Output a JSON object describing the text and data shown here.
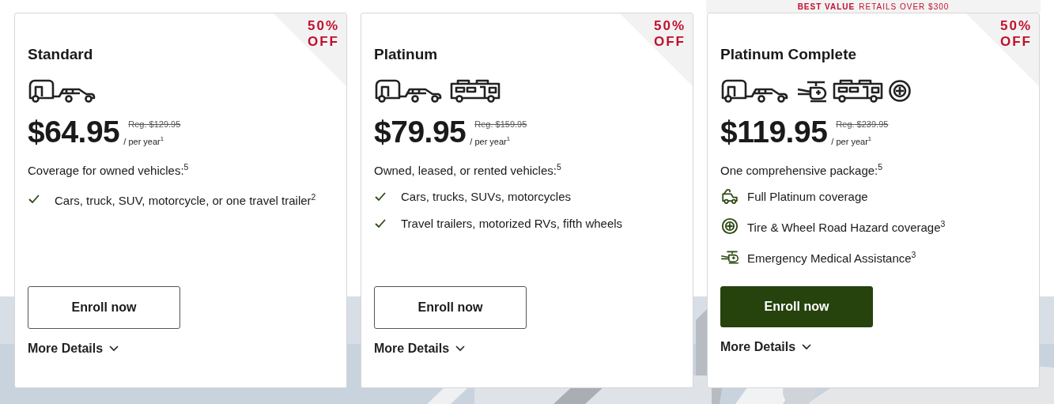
{
  "plans": [
    {
      "name": "Standard",
      "discount": [
        "50%",
        "OFF"
      ],
      "vehicles": [
        {
          "kind": "trailer-car"
        }
      ],
      "price": "$64.95",
      "regular": "Reg. $129.95",
      "period": "/ per year$^{1}$",
      "description": "Coverage for owned vehicles:$^{5}$",
      "features": [
        {
          "kind": "check",
          "text": "Cars, truck, SUV, motorcycle, or one travel trailer$^{2}$"
        }
      ],
      "button": {
        "label": "Enroll now",
        "primary": false
      },
      "details": "More Details"
    },
    {
      "name": "Platinum",
      "discount": [
        "50%",
        "OFF"
      ],
      "vehicles": [
        {
          "kind": "trailer-car"
        },
        {
          "kind": "rv"
        }
      ],
      "price": "$79.95",
      "regular": "Reg. $159.95",
      "period": "/ per year$^{1}$",
      "description": "Owned, leased, or rented vehicles:$^{5}$",
      "features": [
        {
          "kind": "check",
          "text": "Cars, trucks, SUVs, motorcycles"
        },
        {
          "kind": "check",
          "text": "Travel trailers, motorized RVs, fifth wheels"
        }
      ],
      "button": {
        "label": "Enroll now",
        "primary": false
      },
      "details": "More Details"
    },
    {
      "name": "Platinum Complete",
      "banner": {
        "highlight": "BEST VALUE",
        "text": "RETAILS OVER $300"
      },
      "discount": [
        "50%",
        "OFF"
      ],
      "vehicles": [
        {
          "kind": "trailer-car"
        },
        {
          "kind": "helicopter"
        },
        {
          "kind": "rv"
        },
        {
          "kind": "tire"
        }
      ],
      "price": "$119.95",
      "regular": "Reg. $239.95",
      "period": "/ per year$^{1}$",
      "description": "One comprehensive package:$^{5}$",
      "features": [
        {
          "kind": "tow-truck",
          "text": "Full Platinum coverage"
        },
        {
          "kind": "tire",
          "text": "Tire & Wheel Road Hazard coverage$^{3}$"
        },
        {
          "kind": "helicopter",
          "text": "Emergency Medical Assistance$^{3}$"
        }
      ],
      "button": {
        "label": "Enroll now",
        "primary": true
      },
      "details": "More Details"
    }
  ]
}
